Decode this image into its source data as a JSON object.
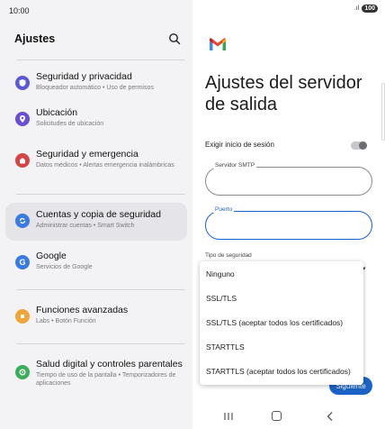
{
  "status": {
    "time": "10:00",
    "battery": "100"
  },
  "left": {
    "title": "Ajustes",
    "items": [
      {
        "title": "Seguridad y privacidad",
        "subtitle": "Bloqueador automático • Uso de permisos",
        "color": "#5b59d6",
        "icon": "shield-icon"
      },
      {
        "title": "Ubicación",
        "subtitle": "Solicitudes de ubicación",
        "color": "#6a4fd1",
        "icon": "location-icon"
      },
      {
        "title": "Seguridad y emergencia",
        "subtitle": "Datos médicos • Alertas emergencia inalámbricas",
        "color": "#d64545",
        "icon": "emergency-icon"
      },
      {
        "title": "Cuentas y copia de seguridad",
        "subtitle": "Administrar cuentas • Smart Switch",
        "color": "#3a7be0",
        "icon": "sync-icon"
      },
      {
        "title": "Google",
        "subtitle": "Servicios de Google",
        "color": "#3a7be0",
        "icon": "google-icon"
      },
      {
        "title": "Funciones avanzadas",
        "subtitle": "Labs • Botón Función",
        "color": "#f0a53a",
        "icon": "advanced-icon"
      },
      {
        "title": "Salud digital y controles parentales",
        "subtitle": "Tiempo de uso de la pantalla • Temporizadores de aplicaciones",
        "color": "#3cae5a",
        "icon": "wellbeing-icon"
      }
    ]
  },
  "right": {
    "title": "Ajustes del servidor de salida",
    "auth_label": "Exigir inicio de sesión",
    "smtp_label": "Servidor SMTP",
    "port_label": "Puerto",
    "security_label": "Tipo de seguridad",
    "next_label": "Siguiente",
    "options": [
      "Ninguno",
      "SSL/TLS",
      "SSL/TLS (aceptar todos los certificados)",
      "STARTTLS",
      "STARTTLS (aceptar todos los certificados)"
    ]
  }
}
